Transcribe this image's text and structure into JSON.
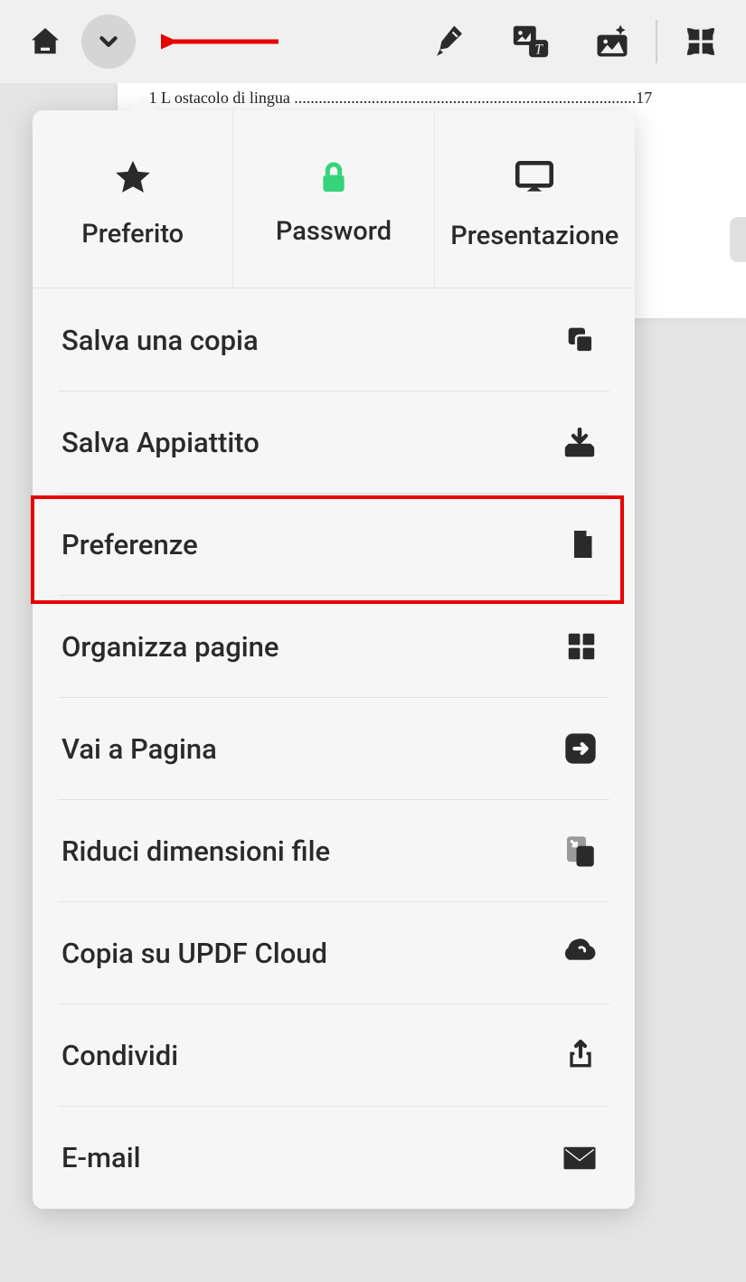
{
  "toolbar": {
    "icons": {
      "home": "home-icon",
      "dropdown": "chevron-down-icon",
      "highlighter": "highlighter-icon",
      "image_text": "image-text-icon",
      "ai_image": "ai-image-icon",
      "grid": "grid-icon"
    }
  },
  "doc_preview": {
    "line": ".1 L ostacolo di lingua ....................................................................................17"
  },
  "menu": {
    "top": [
      {
        "label": "Preferito",
        "icon": "star-icon"
      },
      {
        "label": "Password",
        "icon": "lock-icon"
      },
      {
        "label": "Presentazione",
        "icon": "presentation-icon"
      }
    ],
    "items": [
      {
        "label": "Salva una copia",
        "icon": "copy-icon"
      },
      {
        "label": "Salva Appiattito",
        "icon": "save-flat-icon"
      },
      {
        "label": "Preferenze",
        "icon": "page-icon",
        "highlighted": true
      },
      {
        "label": "Organizza pagine",
        "icon": "grid4-icon"
      },
      {
        "label": "Vai a Pagina",
        "icon": "arrow-right-icon"
      },
      {
        "label": "Riduci dimensioni file",
        "icon": "reduce-file-icon"
      },
      {
        "label": "Copia su UPDF Cloud",
        "icon": "cloud-icon"
      },
      {
        "label": "Condividi",
        "icon": "share-icon"
      },
      {
        "label": "E-mail",
        "icon": "email-icon"
      }
    ]
  }
}
